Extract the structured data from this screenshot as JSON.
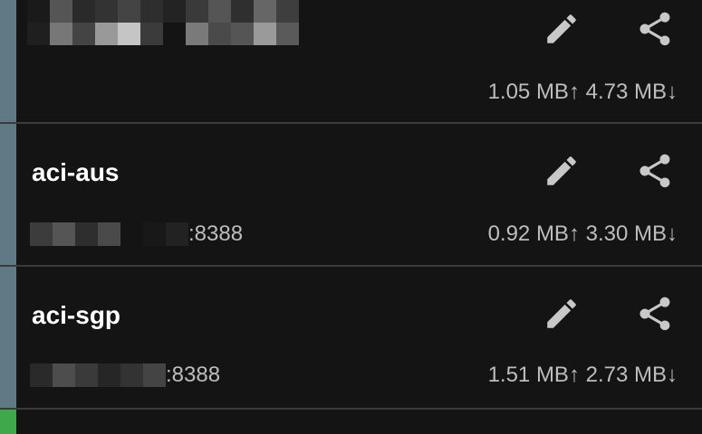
{
  "servers": [
    {
      "name": "",
      "address_suffix": "",
      "traffic": "1.05 MB↑ 4.73 MB↓",
      "edit_icon": "pencil-icon",
      "share_icon": "share-icon",
      "stripe_color": "#5f7a85"
    },
    {
      "name": "aci-aus",
      "address_suffix": ":8388",
      "traffic": "0.92 MB↑ 3.30 MB↓",
      "edit_icon": "pencil-icon",
      "share_icon": "share-icon",
      "stripe_color": "#5f7a85"
    },
    {
      "name": "aci-sgp",
      "address_suffix": ":8388",
      "traffic": "1.51 MB↑ 2.73 MB↓",
      "edit_icon": "pencil-icon",
      "share_icon": "share-icon",
      "stripe_color": "#5f7a85"
    }
  ],
  "next_item_stripe_color": "#3ea84a",
  "colors": {
    "background": "#141414",
    "title_text": "#ffffff",
    "secondary_text": "#bdbdbd",
    "icon": "#c8c8c8",
    "divider": "#3b3b3b"
  }
}
